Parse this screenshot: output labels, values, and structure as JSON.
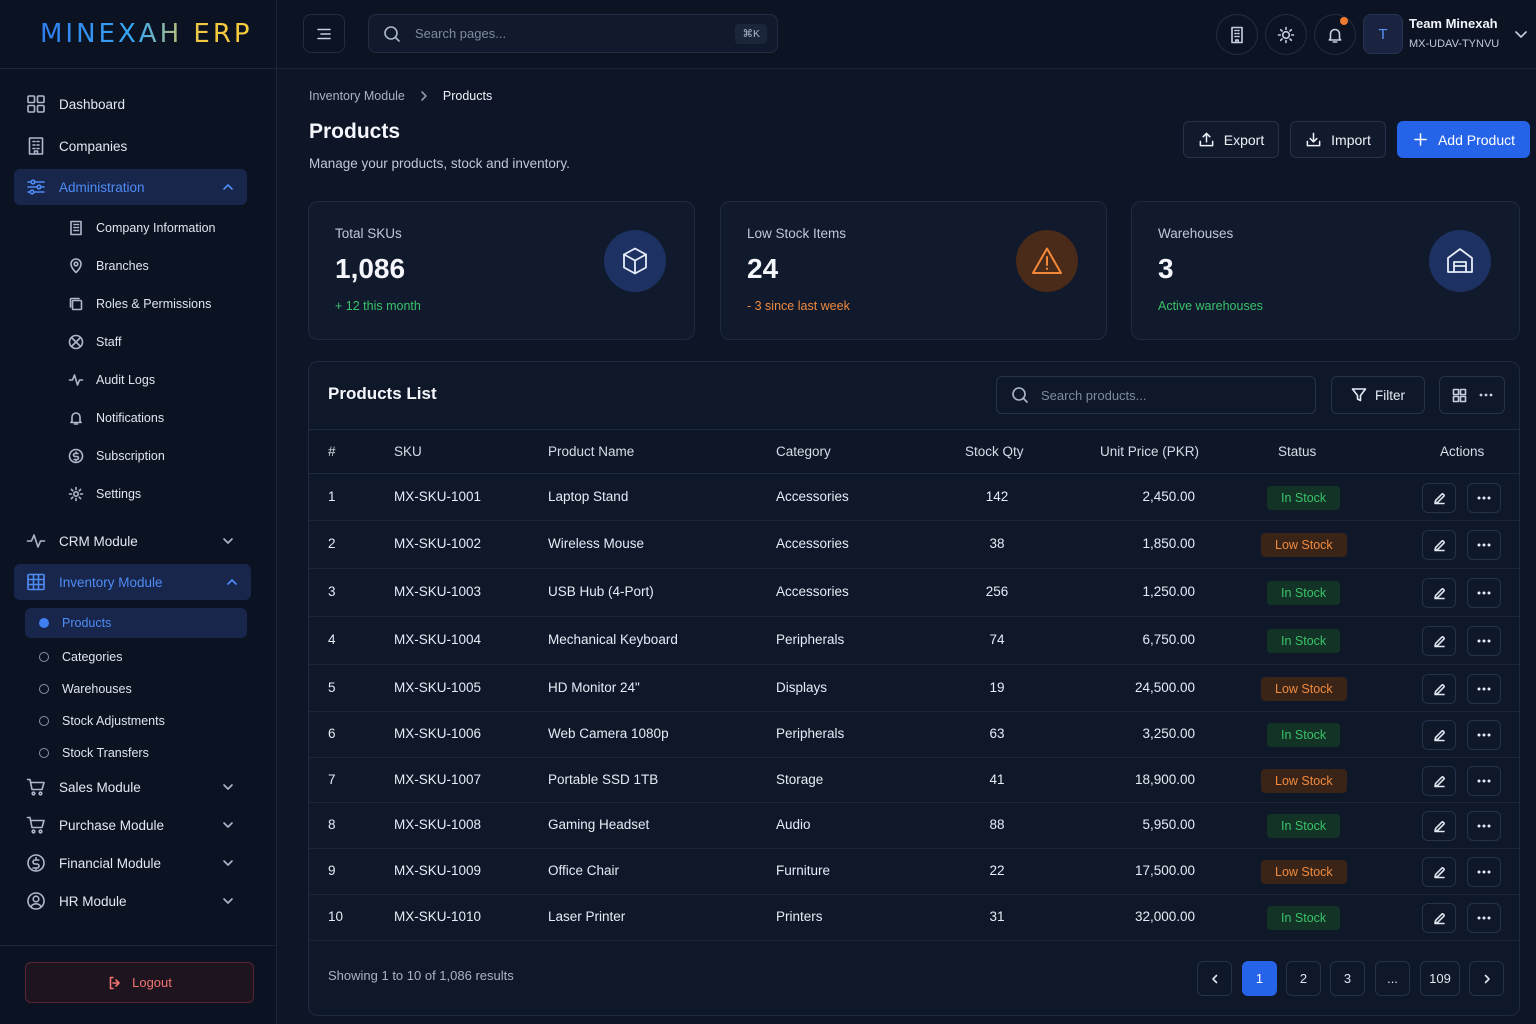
{
  "app": {
    "logo": "MINEXAH ERP"
  },
  "topbar": {
    "search_placeholder": "Search pages...",
    "shortcut": "⌘K",
    "user_name": "Team Minexah",
    "user_id": "MX-UDAV-TYNVU",
    "avatar_letter": "T"
  },
  "sidebar": {
    "dashboard": "Dashboard",
    "companies": "Companies",
    "administration": "Administration",
    "admin_items": [
      "Company Information",
      "Branches",
      "Roles & Permissions",
      "Staff",
      "Audit Logs",
      "Notifications",
      "Subscription",
      "Settings"
    ],
    "crm": "CRM Module",
    "inventory": "Inventory Module",
    "inventory_items": [
      "Products",
      "Categories",
      "Warehouses",
      "Stock Adjustments",
      "Stock Transfers"
    ],
    "sales": "Sales Module",
    "purchase": "Purchase Module",
    "financial": "Financial Module",
    "hr": "HR Module",
    "logout": "Logout"
  },
  "page": {
    "breadcrumb_parent": "Inventory Module",
    "breadcrumb_current": "Products",
    "title": "Products",
    "subtitle": "Manage your products, stock and inventory.",
    "export": "Export",
    "import": "Import",
    "add_product": "Add Product"
  },
  "stats": [
    {
      "label": "Total SKUs",
      "value": "1,086",
      "delta": "+ 12 this month",
      "color": "#39c26a"
    },
    {
      "label": "Low Stock Items",
      "value": "24",
      "delta": "- 3 since last week",
      "color": "#f08a3e"
    },
    {
      "label": "Warehouses",
      "value": "3",
      "delta": "Active warehouses",
      "color": "#39c26a"
    }
  ],
  "table": {
    "title": "Products List",
    "search_placeholder": "Search products...",
    "filter": "Filter",
    "columns": [
      "#",
      "SKU",
      "Product Name",
      "Category",
      "Stock Qty",
      "Unit Price (PKR)",
      "Status",
      "Actions"
    ],
    "rows": [
      {
        "n": "1",
        "sku": "MX-SKU-1001",
        "name": "Laptop Stand",
        "category": "Accessories",
        "qty": "142",
        "price": "2,450.00",
        "status": "In Stock"
      },
      {
        "n": "2",
        "sku": "MX-SKU-1002",
        "name": "Wireless Mouse",
        "category": "Accessories",
        "qty": "38",
        "price": "1,850.00",
        "status": "Low Stock"
      },
      {
        "n": "3",
        "sku": "MX-SKU-1003",
        "name": "USB Hub (4-Port)",
        "category": "Accessories",
        "qty": "256",
        "price": "1,250.00",
        "status": "In Stock"
      },
      {
        "n": "4",
        "sku": "MX-SKU-1004",
        "name": "Mechanical Keyboard",
        "category": "Peripherals",
        "qty": "74",
        "price": "6,750.00",
        "status": "In Stock"
      },
      {
        "n": "5",
        "sku": "MX-SKU-1005",
        "name": "HD Monitor 24\"",
        "category": "Displays",
        "qty": "19",
        "price": "24,500.00",
        "status": "Low Stock"
      },
      {
        "n": "6",
        "sku": "MX-SKU-1006",
        "name": "Web Camera 1080p",
        "category": "Peripherals",
        "qty": "63",
        "price": "3,250.00",
        "status": "In Stock"
      },
      {
        "n": "7",
        "sku": "MX-SKU-1007",
        "name": "Portable SSD 1TB",
        "category": "Storage",
        "qty": "41",
        "price": "18,900.00",
        "status": "Low Stock"
      },
      {
        "n": "8",
        "sku": "MX-SKU-1008",
        "name": "Gaming Headset",
        "category": "Audio",
        "qty": "88",
        "price": "5,950.00",
        "status": "In Stock"
      },
      {
        "n": "9",
        "sku": "MX-SKU-1009",
        "name": "Office Chair",
        "category": "Furniture",
        "qty": "22",
        "price": "17,500.00",
        "status": "Low Stock"
      },
      {
        "n": "10",
        "sku": "MX-SKU-1010",
        "name": "Laser Printer",
        "category": "Printers",
        "qty": "31",
        "price": "32,000.00",
        "status": "In Stock"
      }
    ],
    "showing": "Showing 1 to 10 of 1,086 results",
    "pages": [
      "1",
      "2",
      "3",
      "...",
      "109"
    ]
  }
}
